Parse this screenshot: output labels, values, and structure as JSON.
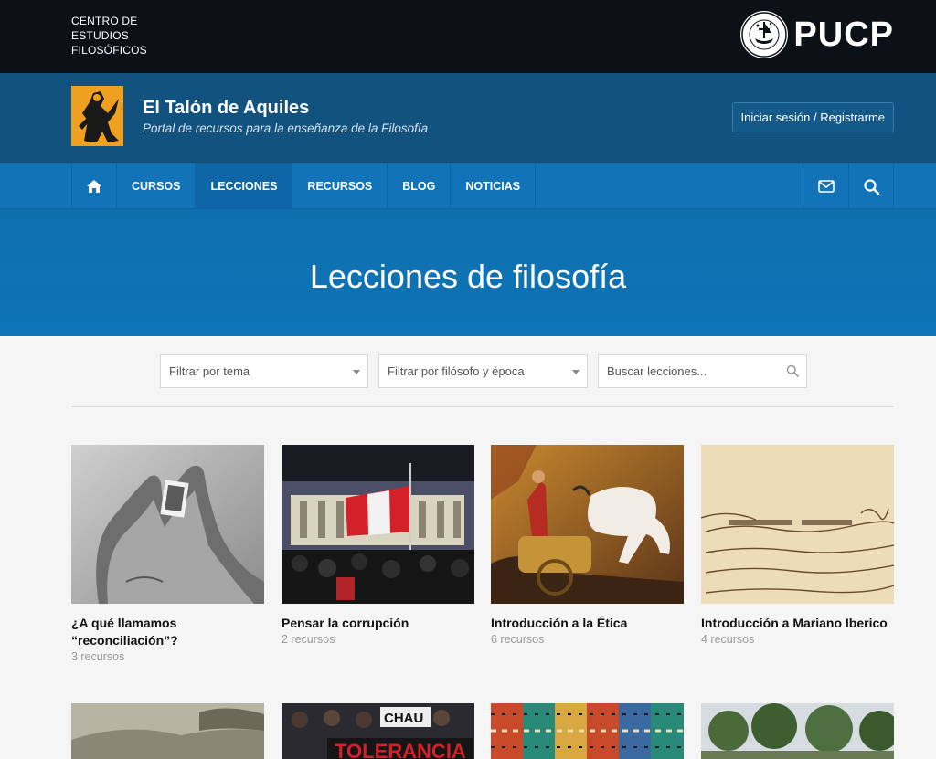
{
  "topbar": {
    "org_lines": [
      "CENTRO DE",
      "ESTUDIOS",
      "FILOSÓFICOS"
    ],
    "brand": "PUCP"
  },
  "header": {
    "title": "El Talón de Aquiles",
    "subtitle": "Portal de recursos para la enseñanza de la Filosofía",
    "login_label": "Iniciar sesión / Registrarme"
  },
  "nav": {
    "items": [
      {
        "label": "CURSOS"
      },
      {
        "label": "LECCIONES",
        "active": true
      },
      {
        "label": "RECURSOS"
      },
      {
        "label": "BLOG"
      },
      {
        "label": "NOTICIAS"
      }
    ],
    "icons": [
      "home-icon",
      "mail-icon",
      "search-icon"
    ]
  },
  "hero": {
    "title": "Lecciones de filosofía"
  },
  "filters": {
    "theme": "Filtrar por tema",
    "philosopher": "Filtrar por filósofo y época",
    "search_placeholder": "Buscar lecciones..."
  },
  "lessons": [
    {
      "title": "¿A qué llamamos “reconciliación”?",
      "count": "3 recursos"
    },
    {
      "title": "Pensar la corrupción",
      "count": "2 recursos"
    },
    {
      "title": "Introducción a la Ética",
      "count": "6 recursos"
    },
    {
      "title": "Introducción a Mariano Iberico",
      "count": "4 recursos"
    }
  ],
  "second_row": {
    "banner_text": "TOLERANCIA",
    "sign_text": "CHAU"
  },
  "colors": {
    "topbar": "#0b1117",
    "header": "#11527f",
    "nav": "#1273b9",
    "hero": "#0f6fae",
    "logo": "#f0a021"
  }
}
